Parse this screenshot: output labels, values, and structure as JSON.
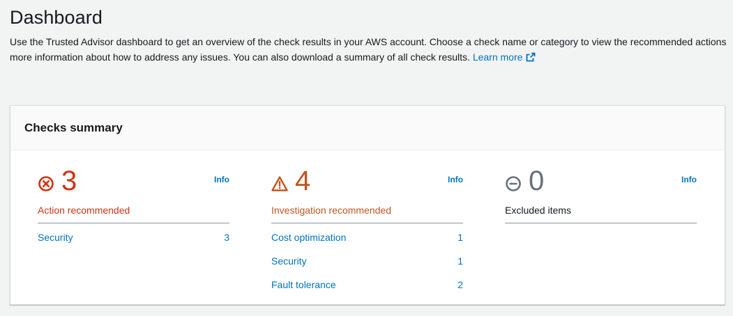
{
  "page": {
    "title": "Dashboard",
    "description_line1": "Use the Trusted Advisor dashboard to get an overview of the check results in your AWS account. Choose a check name or category to view the recommended actions",
    "description_line2": "more information about how to address any issues. You can also download a summary of all check results.",
    "learn_more": "Learn more"
  },
  "checks_summary": {
    "title": "Checks summary",
    "columns": [
      {
        "count": "3",
        "label": "Action recommended",
        "info": "Info",
        "icon": "error-circle-icon",
        "color": "#d13212",
        "categories": [
          {
            "name": "Security",
            "count": "3"
          }
        ]
      },
      {
        "count": "4",
        "label": "Investigation recommended",
        "info": "Info",
        "icon": "warning-triangle-icon",
        "color": "#c0561f",
        "categories": [
          {
            "name": "Cost optimization",
            "count": "1"
          },
          {
            "name": "Security",
            "count": "1"
          },
          {
            "name": "Fault tolerance",
            "count": "2"
          }
        ]
      },
      {
        "count": "0",
        "label": "Excluded items",
        "info": "Info",
        "icon": "excluded-circle-icon",
        "color": "#687078",
        "categories": []
      }
    ]
  }
}
